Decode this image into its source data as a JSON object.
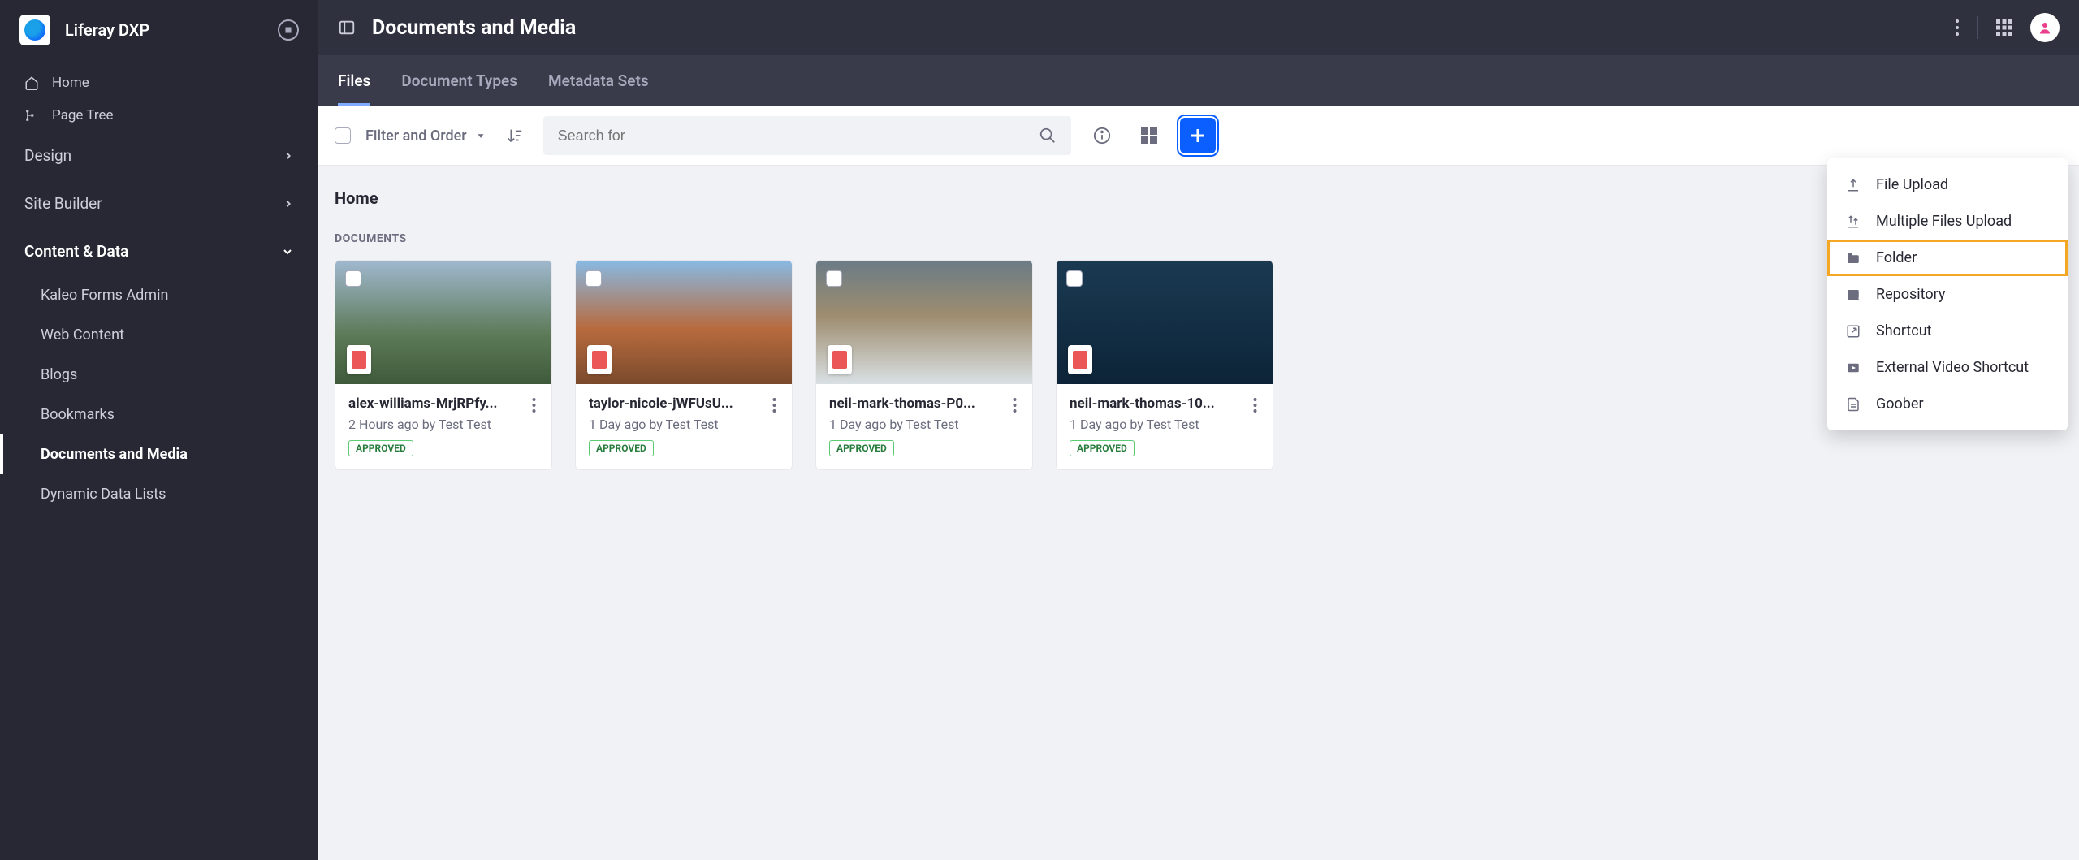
{
  "brand": {
    "name": "Liferay DXP"
  },
  "sidebar": {
    "home": "Home",
    "pagetree": "Page Tree",
    "groups": [
      {
        "label": "Design",
        "open": false
      },
      {
        "label": "Site Builder",
        "open": false
      },
      {
        "label": "Content & Data",
        "open": true
      }
    ],
    "subitems": [
      {
        "label": "Kaleo Forms Admin"
      },
      {
        "label": "Web Content"
      },
      {
        "label": "Blogs"
      },
      {
        "label": "Bookmarks"
      },
      {
        "label": "Documents and Media",
        "active": true
      },
      {
        "label": "Dynamic Data Lists"
      }
    ]
  },
  "header": {
    "title": "Documents and Media"
  },
  "tabs": [
    {
      "label": "Files",
      "active": true
    },
    {
      "label": "Document Types"
    },
    {
      "label": "Metadata Sets"
    }
  ],
  "toolbar": {
    "filter_label": "Filter and Order",
    "search_placeholder": "Search for"
  },
  "add_menu": [
    {
      "icon": "upload",
      "label": "File Upload"
    },
    {
      "icon": "upload-multi",
      "label": "Multiple Files Upload"
    },
    {
      "icon": "folder",
      "label": "Folder",
      "highlight": true
    },
    {
      "icon": "repo",
      "label": "Repository"
    },
    {
      "icon": "shortcut",
      "label": "Shortcut"
    },
    {
      "icon": "video",
      "label": "External Video Shortcut"
    },
    {
      "icon": "doc",
      "label": "Goober"
    }
  ],
  "breadcrumb": "Home",
  "section_label": "DOCUMENTS",
  "status_approved": "APPROVED",
  "documents": [
    {
      "title": "alex-williams-MrjRPfy...",
      "meta": "2 Hours ago by Test Test",
      "status": "APPROVED",
      "thumb": "thumb1"
    },
    {
      "title": "taylor-nicole-jWFUsU...",
      "meta": "1 Day ago by Test Test",
      "status": "APPROVED",
      "thumb": "thumb2"
    },
    {
      "title": "neil-mark-thomas-P0...",
      "meta": "1 Day ago by Test Test",
      "status": "APPROVED",
      "thumb": "thumb3"
    },
    {
      "title": "neil-mark-thomas-10...",
      "meta": "1 Day ago by Test Test",
      "status": "APPROVED",
      "thumb": "thumb4"
    }
  ]
}
